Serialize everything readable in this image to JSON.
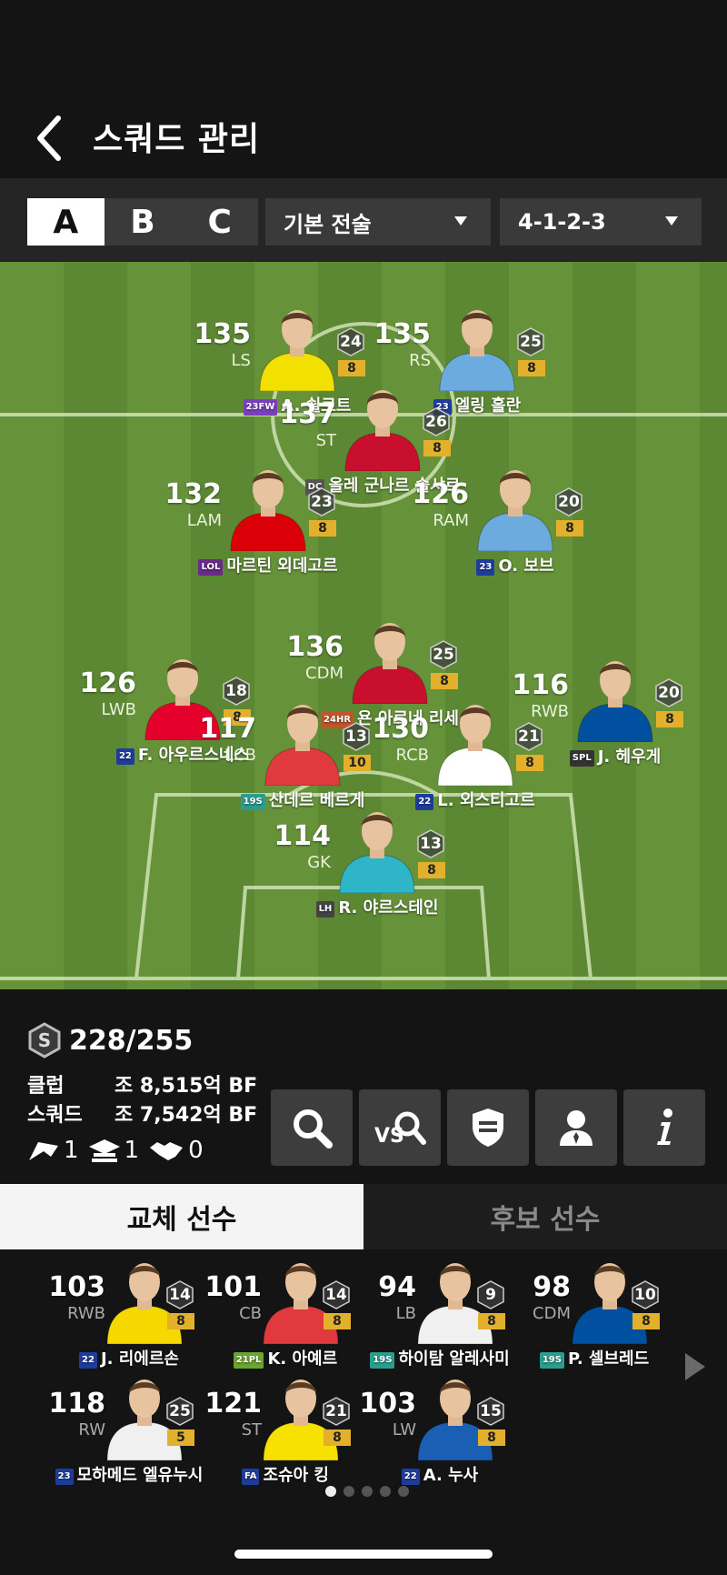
{
  "header": {
    "title": "스쿼드 관리"
  },
  "controls": {
    "squad_tabs": [
      "A",
      "B",
      "C"
    ],
    "active_tab": "A",
    "tactic": "기본 전술",
    "formation": "4-1-2-3"
  },
  "colors": {
    "grade": "#e2b02a",
    "pitch_light": "#66923a",
    "pitch_dark": "#5c8833"
  },
  "pitch_players": [
    {
      "ovr": "135",
      "pos": "LS",
      "cost": "24",
      "grade": "8",
      "badge": "23FW",
      "badge_color": "#7a3fbf",
      "name": "A. 쇨로트",
      "kit": "#f2e100"
    },
    {
      "ovr": "135",
      "pos": "RS",
      "cost": "25",
      "grade": "8",
      "badge": "23",
      "badge_color": "#1e3c9c",
      "name": "엘링 홀란",
      "kit": "#6cabdd"
    },
    {
      "ovr": "137",
      "pos": "ST",
      "cost": "26",
      "grade": "8",
      "badge": "DC",
      "badge_color": "#555555",
      "name": "올레 군나르 솔샤르",
      "kit": "#c8102e"
    },
    {
      "ovr": "132",
      "pos": "LAM",
      "cost": "23",
      "grade": "8",
      "badge": "LOL",
      "badge_color": "#6a2a8a",
      "name": "마르틴 외데고르",
      "kit": "#db0007"
    },
    {
      "ovr": "126",
      "pos": "RAM",
      "cost": "20",
      "grade": "8",
      "badge": "23",
      "badge_color": "#1e3c9c",
      "name": "O. 보브",
      "kit": "#6cabdd"
    },
    {
      "ovr": "136",
      "pos": "CDM",
      "cost": "25",
      "grade": "8",
      "badge": "24HR",
      "badge_color": "#c0542a",
      "name": "욘 아르네 리세",
      "kit": "#c8102e"
    },
    {
      "ovr": "126",
      "pos": "LWB",
      "cost": "18",
      "grade": "8",
      "badge": "22",
      "badge_color": "#1e3c9c",
      "name": "F. 아우르스네스",
      "kit": "#e4002b"
    },
    {
      "ovr": "116",
      "pos": "RWB",
      "cost": "20",
      "grade": "8",
      "badge": "SPL",
      "badge_color": "#333333",
      "name": "J. 헤우게",
      "kit": "#0050a0"
    },
    {
      "ovr": "117",
      "pos": "LCB",
      "cost": "13",
      "grade": "10",
      "badge": "19S",
      "badge_color": "#2a9d8f",
      "name": "산데르 베르게",
      "kit": "#e03a3e"
    },
    {
      "ovr": "130",
      "pos": "RCB",
      "cost": "21",
      "grade": "8",
      "badge": "22",
      "badge_color": "#1e3c9c",
      "name": "L. 외스티고르",
      "kit": "#ffffff"
    },
    {
      "ovr": "114",
      "pos": "GK",
      "cost": "13",
      "grade": "8",
      "badge": "LH",
      "badge_color": "#444444",
      "name": "R. 야르스테인",
      "kit": "#2fb5c8"
    }
  ],
  "stats": {
    "ovr_total": "228/255",
    "club_label": "클럽",
    "club_value": "조 8,515억 BF",
    "squad_label": "스쿼드",
    "squad_value": "조 7,542억 BF",
    "chem1": "1",
    "chem2": "1",
    "chem3": "0"
  },
  "subtabs": [
    "교체 선수",
    "후보 선수"
  ],
  "bench_players": [
    {
      "ovr": "103",
      "pos": "RWB",
      "cost": "14",
      "grade": "8",
      "badge": "22",
      "badge_color": "#1e3c9c",
      "name": "J. 리에르손",
      "kit": "#f5d800"
    },
    {
      "ovr": "101",
      "pos": "CB",
      "cost": "14",
      "grade": "8",
      "badge": "21PL",
      "badge_color": "#6aa532",
      "name": "K. 아예르",
      "kit": "#e03a3e"
    },
    {
      "ovr": "94",
      "pos": "LB",
      "cost": "9",
      "grade": "8",
      "badge": "19S",
      "badge_color": "#2a9d8f",
      "name": "하이탐 알레사미",
      "kit": "#f0f0f0"
    },
    {
      "ovr": "98",
      "pos": "CDM",
      "cost": "10",
      "grade": "8",
      "badge": "19S",
      "badge_color": "#2a9d8f",
      "name": "P. 셀브레드",
      "kit": "#0050a0"
    },
    {
      "ovr": "118",
      "pos": "RW",
      "cost": "25",
      "grade": "5",
      "badge": "23",
      "badge_color": "#1e3c9c",
      "name": "모하메드 엘유누시",
      "kit": "#f0f0f0"
    },
    {
      "ovr": "121",
      "pos": "ST",
      "cost": "21",
      "grade": "8",
      "badge": "FA",
      "badge_color": "#1e3c9c",
      "name": "조슈아 킹",
      "kit": "#f6e100"
    },
    {
      "ovr": "103",
      "pos": "LW",
      "cost": "15",
      "grade": "8",
      "badge": "22",
      "badge_color": "#1e3c9c",
      "name": "A. 누사",
      "kit": "#1a5fb4"
    }
  ]
}
